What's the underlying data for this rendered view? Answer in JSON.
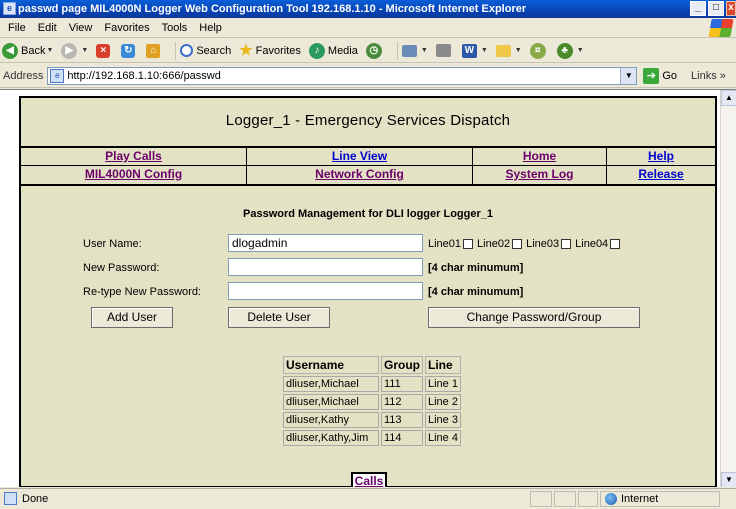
{
  "window": {
    "title": "passwd page MIL4000N Logger Web Configuration Tool 192.168.1.10 - Microsoft Internet Explorer",
    "minimize": "_",
    "maximize": "□",
    "close": "x"
  },
  "menu": {
    "file": "File",
    "edit": "Edit",
    "view": "View",
    "favorites": "Favorites",
    "tools": "Tools",
    "help": "Help"
  },
  "toolbar": {
    "back": "Back",
    "search": "Search",
    "favorites": "Favorites",
    "media": "Media"
  },
  "address": {
    "label": "Address",
    "url": "http://192.168.1.10:666/passwd",
    "go": "Go",
    "links": "Links »"
  },
  "page": {
    "title": "Logger_1 - Emergency Services Dispatch",
    "nav_row1": [
      {
        "label": "Play Calls",
        "visited": true
      },
      {
        "label": "Line View",
        "visited": false
      },
      {
        "label": "Home",
        "visited": true
      },
      {
        "label": "Help",
        "visited": false
      }
    ],
    "nav_row2": [
      {
        "label": "MIL4000N Config",
        "visited": true
      },
      {
        "label": "Network Config",
        "visited": true
      },
      {
        "label": "System Log",
        "visited": true
      },
      {
        "label": "Release",
        "visited": false
      }
    ],
    "section_title": "Password Management for DLI logger Logger_1",
    "form": {
      "username_label": "User Name:",
      "username_value": "dlogadmin",
      "new_password_label": "New Password:",
      "retype_password_label": "Re-type New Password:",
      "min_hint_1": "[4 char minumum]",
      "min_hint_2": "[4 char minumum]",
      "lines": [
        "Line01",
        "Line02",
        "Line03",
        "Line04"
      ]
    },
    "buttons": {
      "add_user": "Add User",
      "delete_user": "Delete User",
      "change_password": "Change Password/Group"
    },
    "table": {
      "headers": [
        "Username",
        "Group",
        "Line"
      ],
      "rows": [
        [
          "dliuser,Michael",
          "111",
          "Line 1"
        ],
        [
          "dliuser,Michael",
          "112",
          "Line 2"
        ],
        [
          "dliuser,Kathy",
          "113",
          "Line 3"
        ],
        [
          "dliuser,Kathy,Jim",
          "114",
          "Line 4"
        ]
      ]
    },
    "calls_link": "Calls"
  },
  "status": {
    "text": "Done",
    "zone": "Internet"
  }
}
